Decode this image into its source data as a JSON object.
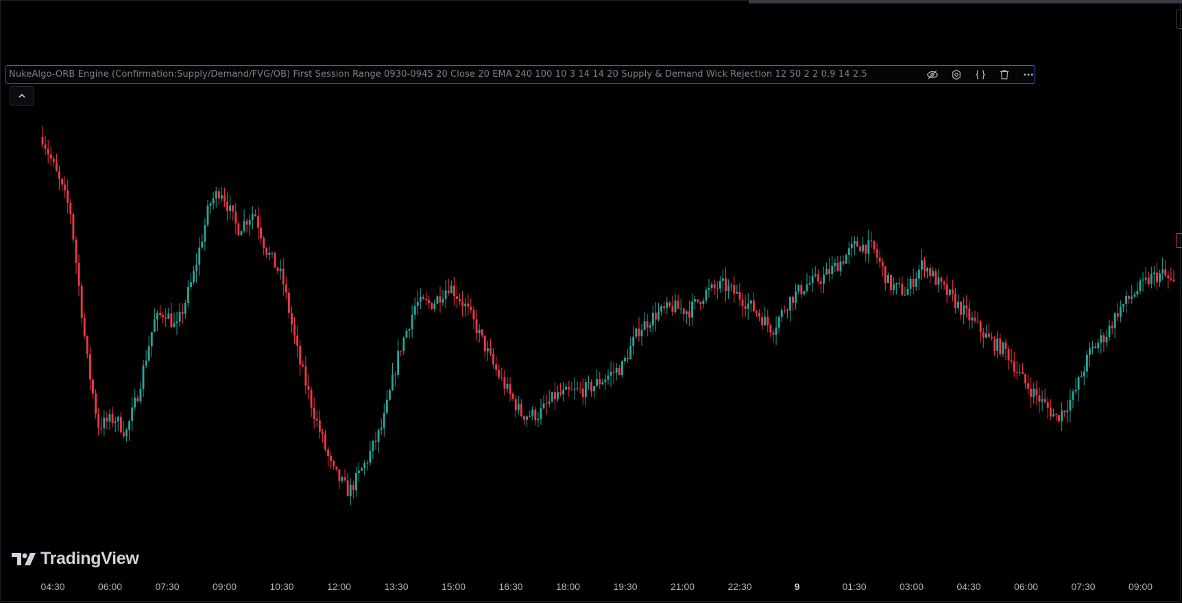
{
  "indicator_legend": {
    "text": "NukeAlgo-ORB Engine (Confirmation:Supply/Demand/FVG/OB) First Session Range 0930-0945 20 Close 20 EMA 240 100 10 3 14 14 20 Supply & Demand Wick Rejection 12 50 2 2 0.9 14 2.5",
    "buttons": [
      {
        "name": "hide-eye-icon"
      },
      {
        "name": "settings-gear-icon"
      },
      {
        "name": "source-code-icon"
      },
      {
        "name": "delete-trash-icon"
      },
      {
        "name": "more-options-icon"
      }
    ]
  },
  "collapse_button": {
    "icon": "chevron-up-icon"
  },
  "branding": {
    "name": "TradingView"
  },
  "time_axis": {
    "ticks": [
      {
        "label": "04:30"
      },
      {
        "label": "06:00"
      },
      {
        "label": "07:30"
      },
      {
        "label": "09:00"
      },
      {
        "label": "10:30"
      },
      {
        "label": "12:00"
      },
      {
        "label": "13:30"
      },
      {
        "label": "15:00"
      },
      {
        "label": "16:30"
      },
      {
        "label": "18:00"
      },
      {
        "label": "19:30"
      },
      {
        "label": "21:00"
      },
      {
        "label": "22:30"
      },
      {
        "label": "9",
        "bold": true
      },
      {
        "label": "01:30"
      },
      {
        "label": "03:00"
      },
      {
        "label": "04:30"
      },
      {
        "label": "06:00"
      },
      {
        "label": "07:30"
      },
      {
        "label": "09:00"
      }
    ]
  },
  "colors": {
    "up": "#26a69a",
    "down": "#f23645",
    "background": "#000000",
    "legend_border": "#2962ff",
    "axis_text": "#b2b5be"
  },
  "chart_data": {
    "type": "candlestick",
    "price_path": [
      [
        0,
        100
      ],
      [
        5,
        80
      ],
      [
        8,
        40
      ],
      [
        10,
        22
      ],
      [
        13,
        24
      ],
      [
        15,
        20
      ],
      [
        17,
        30
      ],
      [
        20,
        50
      ],
      [
        22,
        53
      ],
      [
        24,
        48
      ],
      [
        27,
        62
      ],
      [
        30,
        82
      ],
      [
        32,
        86
      ],
      [
        35,
        75
      ],
      [
        38,
        80
      ],
      [
        40,
        70
      ],
      [
        43,
        62
      ],
      [
        46,
        40
      ],
      [
        49,
        24
      ],
      [
        52,
        10
      ],
      [
        55,
        4
      ],
      [
        58,
        12
      ],
      [
        61,
        22
      ],
      [
        64,
        42
      ],
      [
        67,
        55
      ],
      [
        70,
        55
      ],
      [
        73,
        60
      ],
      [
        76,
        54
      ],
      [
        78,
        48
      ],
      [
        81,
        38
      ],
      [
        84,
        30
      ],
      [
        86,
        25
      ],
      [
        89,
        25
      ],
      [
        92,
        30
      ],
      [
        95,
        31
      ],
      [
        98,
        32
      ],
      [
        101,
        35
      ],
      [
        104,
        38
      ],
      [
        107,
        48
      ],
      [
        110,
        52
      ],
      [
        113,
        54
      ],
      [
        116,
        53
      ],
      [
        119,
        58
      ],
      [
        122,
        60
      ],
      [
        125,
        57
      ],
      [
        128,
        53
      ],
      [
        131,
        48
      ],
      [
        134,
        56
      ],
      [
        137,
        60
      ],
      [
        140,
        62
      ],
      [
        143,
        66
      ],
      [
        146,
        71
      ],
      [
        149,
        70
      ],
      [
        152,
        60
      ],
      [
        155,
        58
      ],
      [
        158,
        66
      ],
      [
        161,
        60
      ],
      [
        164,
        55
      ],
      [
        167,
        50
      ],
      [
        170,
        45
      ],
      [
        173,
        42
      ],
      [
        176,
        34
      ],
      [
        179,
        29
      ],
      [
        182,
        24
      ],
      [
        185,
        30
      ],
      [
        188,
        42
      ],
      [
        191,
        47
      ],
      [
        193,
        53
      ],
      [
        196,
        58
      ],
      [
        199,
        62
      ],
      [
        201,
        63
      ],
      [
        203,
        60
      ]
    ]
  }
}
